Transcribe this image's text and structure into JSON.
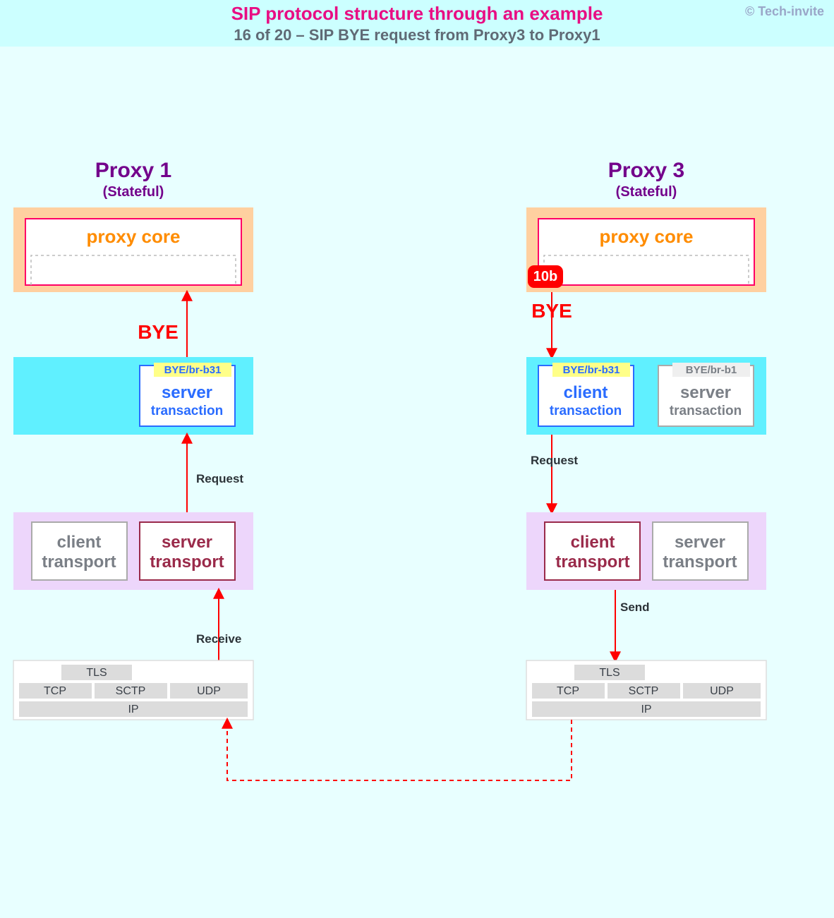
{
  "header": {
    "title": "SIP protocol structure through an example",
    "subtitle": "16 of 20 – SIP BYE request from Proxy3 to Proxy1",
    "copyright": "© Tech-invite"
  },
  "columns": {
    "left": {
      "name": "Proxy 1",
      "sub": "(Stateful)"
    },
    "right": {
      "name": "Proxy 3",
      "sub": "(Stateful)"
    }
  },
  "layer_proxy_core": {
    "label": "proxy core",
    "step_badge": "10b"
  },
  "between_core_tx": {
    "left_bye": "BYE",
    "right_bye": "BYE"
  },
  "layer_transaction": {
    "left": {
      "box": {
        "role_a": "server",
        "role_b": "transaction",
        "tag": "BYE/br-b31",
        "highlight": true
      }
    },
    "right": {
      "boxA": {
        "role_a": "client",
        "role_b": "transaction",
        "tag": "BYE/br-b31",
        "highlight": true
      },
      "boxB": {
        "role_a": "server",
        "role_b": "transaction",
        "tag": "BYE/br-b1",
        "highlight": false
      }
    }
  },
  "between_tx_tp": {
    "left_label": "Request",
    "right_label": "Request"
  },
  "layer_transport": {
    "left": {
      "boxA": {
        "role_a": "client",
        "role_b": "transport",
        "highlight": false
      },
      "boxB": {
        "role_a": "server",
        "role_b": "transport",
        "highlight": true
      }
    },
    "right": {
      "boxA": {
        "role_a": "client",
        "role_b": "transport",
        "highlight": true
      },
      "boxB": {
        "role_a": "server",
        "role_b": "transport",
        "highlight": false
      }
    }
  },
  "between_tp_stk": {
    "left_label": "Receive",
    "right_label": "Send"
  },
  "stack": {
    "tls": "TLS",
    "tcp": "TCP",
    "sctp": "SCTP",
    "udp": "UDP",
    "ip": "IP"
  }
}
